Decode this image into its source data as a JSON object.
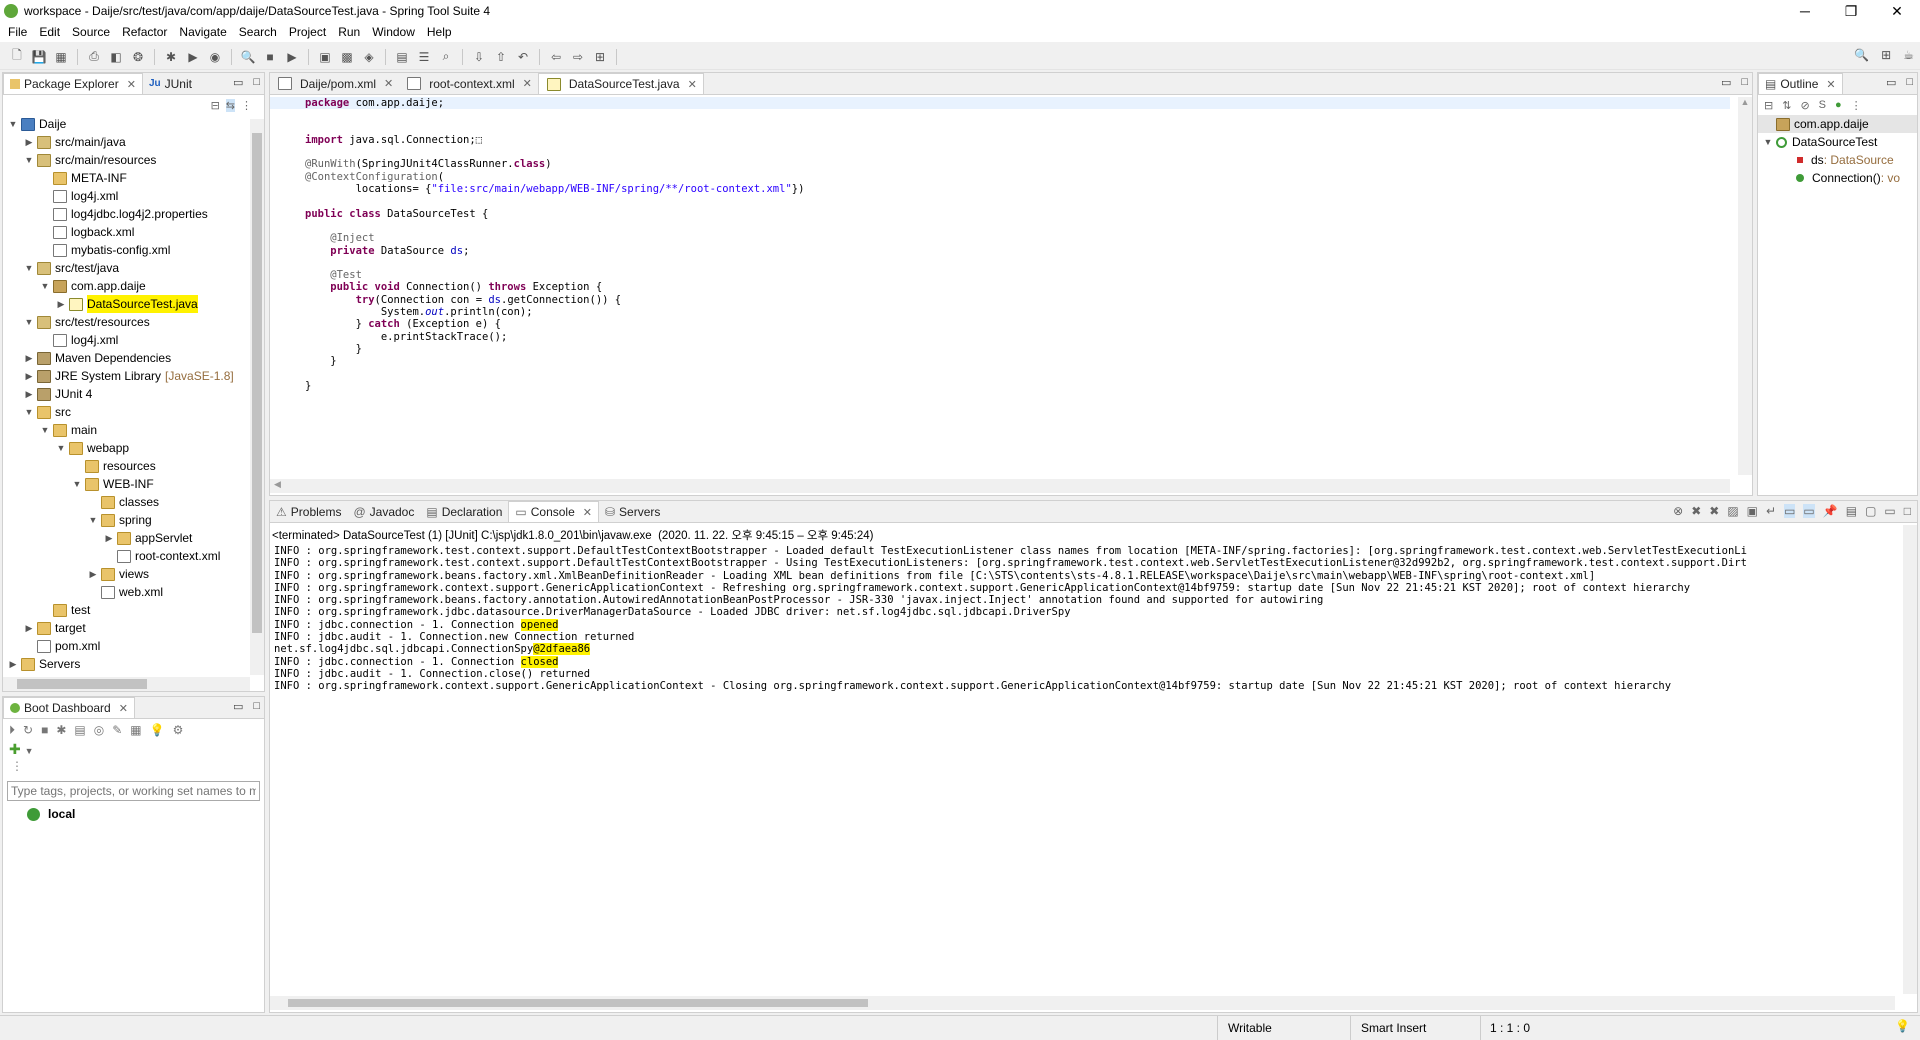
{
  "window": {
    "title": "workspace - Daije/src/test/java/com/app/daije/DataSourceTest.java - Spring Tool Suite 4",
    "minimize": "─",
    "maximize": "❐",
    "close": "✕"
  },
  "menu": [
    "File",
    "Edit",
    "Source",
    "Refactor",
    "Navigate",
    "Search",
    "Project",
    "Run",
    "Window",
    "Help"
  ],
  "package_explorer": {
    "tabs": [
      "Package Explorer",
      "JUnit"
    ],
    "tree": [
      {
        "label": "Daije",
        "depth": 0,
        "tw": "▼",
        "icon": "proj"
      },
      {
        "label": "src/main/java",
        "depth": 1,
        "tw": "▶",
        "icon": "pkgf"
      },
      {
        "label": "src/main/resources",
        "depth": 1,
        "tw": "▼",
        "icon": "pkgf"
      },
      {
        "label": "META-INF",
        "depth": 2,
        "tw": "",
        "icon": "fold"
      },
      {
        "label": "log4j.xml",
        "depth": 2,
        "tw": "",
        "icon": "xml"
      },
      {
        "label": "log4jdbc.log4j2.properties",
        "depth": 2,
        "tw": "",
        "icon": "xml"
      },
      {
        "label": "logback.xml",
        "depth": 2,
        "tw": "",
        "icon": "xml"
      },
      {
        "label": "mybatis-config.xml",
        "depth": 2,
        "tw": "",
        "icon": "xml"
      },
      {
        "label": "src/test/java",
        "depth": 1,
        "tw": "▼",
        "icon": "pkgf"
      },
      {
        "label": "com.app.daije",
        "depth": 2,
        "tw": "▼",
        "icon": "pkg"
      },
      {
        "label": "DataSourceTest.java",
        "depth": 3,
        "tw": "▶",
        "icon": "jfile",
        "highlight": true
      },
      {
        "label": "src/test/resources",
        "depth": 1,
        "tw": "▼",
        "icon": "pkgf"
      },
      {
        "label": "log4j.xml",
        "depth": 2,
        "tw": "",
        "icon": "xml"
      },
      {
        "label": "Maven Dependencies",
        "depth": 1,
        "tw": "▶",
        "icon": "lib"
      },
      {
        "label": "JRE System Library",
        "depth": 1,
        "tw": "▶",
        "icon": "lib",
        "suffix": "[JavaSE-1.8]"
      },
      {
        "label": "JUnit 4",
        "depth": 1,
        "tw": "▶",
        "icon": "lib"
      },
      {
        "label": "src",
        "depth": 1,
        "tw": "▼",
        "icon": "fold"
      },
      {
        "label": "main",
        "depth": 2,
        "tw": "▼",
        "icon": "fold"
      },
      {
        "label": "webapp",
        "depth": 3,
        "tw": "▼",
        "icon": "fold"
      },
      {
        "label": "resources",
        "depth": 4,
        "tw": "",
        "icon": "fold"
      },
      {
        "label": "WEB-INF",
        "depth": 4,
        "tw": "▼",
        "icon": "fold"
      },
      {
        "label": "classes",
        "depth": 5,
        "tw": "",
        "icon": "fold"
      },
      {
        "label": "spring",
        "depth": 5,
        "tw": "▼",
        "icon": "fold"
      },
      {
        "label": "appServlet",
        "depth": 6,
        "tw": "▶",
        "icon": "fold"
      },
      {
        "label": "root-context.xml",
        "depth": 6,
        "tw": "",
        "icon": "xml"
      },
      {
        "label": "views",
        "depth": 5,
        "tw": "▶",
        "icon": "fold"
      },
      {
        "label": "web.xml",
        "depth": 5,
        "tw": "",
        "icon": "xml"
      },
      {
        "label": "test",
        "depth": 2,
        "tw": "",
        "icon": "fold"
      },
      {
        "label": "target",
        "depth": 1,
        "tw": "▶",
        "icon": "fold"
      },
      {
        "label": "pom.xml",
        "depth": 1,
        "tw": "",
        "icon": "xml"
      },
      {
        "label": "Servers",
        "depth": 0,
        "tw": "▶",
        "icon": "fold"
      }
    ]
  },
  "boot_dashboard": {
    "tab": "Boot Dashboard",
    "filter_placeholder": "Type tags, projects, or working set names to m",
    "local": "local"
  },
  "editor": {
    "tabs": [
      "Daije/pom.xml",
      "root-context.xml",
      "DataSourceTest.java"
    ],
    "active_tab": 2
  },
  "outline": {
    "tab": "Outline",
    "items": [
      {
        "label": "com.app.daije",
        "depth": 0
      },
      {
        "label": "DataSourceTest",
        "depth": 0
      },
      {
        "label": "ds",
        "type": " : DataSource",
        "depth": 1
      },
      {
        "label": "Connection()",
        "type": " : vo",
        "depth": 1
      }
    ]
  },
  "console": {
    "tabs": [
      "Problems",
      "Javadoc",
      "Declaration",
      "Console",
      "Servers"
    ],
    "active_tab": 3,
    "header": "<terminated> DataSourceTest (1) [JUnit] C:\\jsp\\jdk1.8.0_201\\bin\\javaw.exe  (2020. 11. 22. 오후 9:45:15 – 오후 9:45:24)",
    "lines": [
      "INFO : org.springframework.test.context.support.DefaultTestContextBootstrapper - Loaded default TestExecutionListener class names from location [META-INF/spring.factories]: [org.springframework.test.context.web.ServletTestExecutionLi",
      "INFO : org.springframework.test.context.support.DefaultTestContextBootstrapper - Using TestExecutionListeners: [org.springframework.test.context.web.ServletTestExecutionListener@32d992b2, org.springframework.test.context.support.Dirt",
      "INFO : org.springframework.beans.factory.xml.XmlBeanDefinitionReader - Loading XML bean definitions from file [C:\\STS\\contents\\sts-4.8.1.RELEASE\\workspace\\Daije\\src\\main\\webapp\\WEB-INF\\spring\\root-context.xml]",
      "INFO : org.springframework.context.support.GenericApplicationContext - Refreshing org.springframework.context.support.GenericApplicationContext@14bf9759: startup date [Sun Nov 22 21:45:21 KST 2020]; root of context hierarchy",
      "INFO : org.springframework.beans.factory.annotation.AutowiredAnnotationBeanPostProcessor - JSR-330 'javax.inject.Inject' annotation found and supported for autowiring",
      "INFO : org.springframework.jdbc.datasource.DriverManagerDataSource - Loaded JDBC driver: net.sf.log4jdbc.sql.jdbcapi.DriverSpy",
      "INFO : jdbc.connection - 1. Connection ",
      "INFO : jdbc.audit - 1. Connection.new Connection returned",
      "net.sf.log4jdbc.sql.jdbcapi.ConnectionSpy",
      "INFO : jdbc.connection - 1. Connection ",
      "INFO : jdbc.audit - 1. Connection.close() returned",
      "INFO : org.springframework.context.support.GenericApplicationContext - Closing org.springframework.context.support.GenericApplicationContext@14bf9759: startup date [Sun Nov 22 21:45:21 KST 2020]; root of context hierarchy"
    ],
    "highlights": {
      "6": "opened",
      "8": "@2dfaea86",
      "9": "closed"
    }
  },
  "status": {
    "writable": "Writable",
    "insert": "Smart Insert",
    "position": "1 : 1 : 0"
  }
}
